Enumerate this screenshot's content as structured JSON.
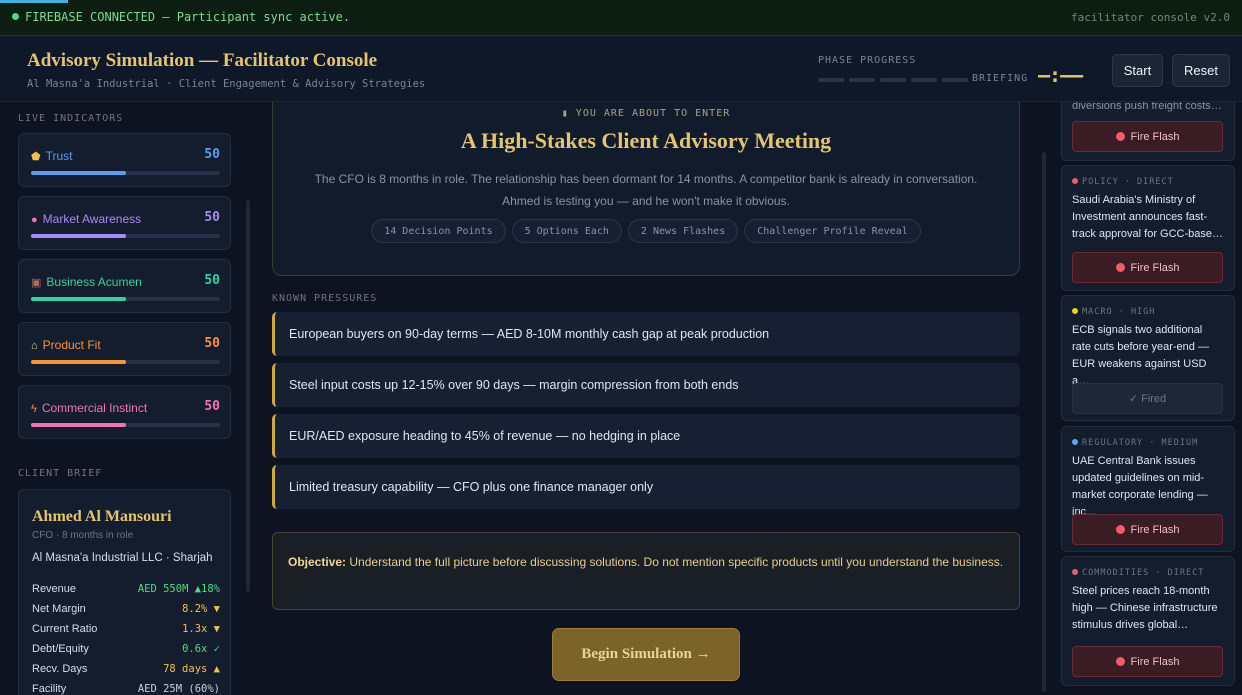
{
  "status_bar": {
    "status_text": "FIREBASE CONNECTED — Participant sync active.",
    "version": "facilitator console v2.0"
  },
  "header": {
    "title": "Advisory Simulation — Facilitator Console",
    "subtitle": "Al Masna'a Industrial · Client Engagement & Advisory Strategies",
    "phase_label": "PHASE PROGRESS",
    "phase_name": "BRIEFING",
    "timer": "–:––",
    "start_label": "Start",
    "reset_label": "Reset"
  },
  "indicators": {
    "section_label": "LIVE INDICATORS",
    "items": [
      {
        "icon": "shield-icon",
        "glyph": "⬟",
        "label": "Trust",
        "value": "50",
        "color": "#5b9df0",
        "level": 0.5
      },
      {
        "icon": "brain-icon",
        "glyph": "●",
        "label": "Market Awareness",
        "value": "50",
        "color": "#a78bfa",
        "level": 0.5
      },
      {
        "icon": "briefcase-icon",
        "glyph": "▣",
        "label": "Business Acumen",
        "value": "50",
        "color": "#34d399",
        "level": 0.5
      },
      {
        "icon": "bank-icon",
        "glyph": "⌂",
        "label": "Product Fit",
        "value": "50",
        "color": "#fb923c",
        "level": 0.5
      },
      {
        "icon": "lightning-icon",
        "glyph": "ϟ",
        "label": "Commercial Instinct",
        "value": "50",
        "color": "#f472b6",
        "level": 0.5
      }
    ]
  },
  "client_brief": {
    "section_label": "CLIENT BRIEF",
    "name": "Ahmed Al Mansouri",
    "role": "CFO · 8 months in role",
    "company": "Al Masna'a Industrial LLC · Sharjah",
    "metrics": [
      {
        "label": "Revenue",
        "value": "AED 550M ▲18%",
        "color": "#4ade80"
      },
      {
        "label": "Net Margin",
        "value": "8.2% ▼",
        "color": "#f5c04a"
      },
      {
        "label": "Current Ratio",
        "value": "1.3x ▼",
        "color": "#f5c04a"
      },
      {
        "label": "Debt/Equity",
        "value": "0.6x ✓",
        "color": "#4ade80"
      },
      {
        "label": "Recv. Days",
        "value": "78 days ▲",
        "color": "#f5c04a"
      },
      {
        "label": "Facility",
        "value": "AED 25M (60%)",
        "color": "#c8cfdb"
      }
    ]
  },
  "intro": {
    "eyebrow": "YOU ARE ABOUT TO ENTER",
    "title": "A High-Stakes Client Advisory Meeting",
    "description": "The CFO is 8 months in role. The relationship has been dormant for 14 months. A competitor bank is already in conversation. Ahmed is testing you — and he won't make it obvious.",
    "chips": [
      "14 Decision Points",
      "5 Options Each",
      "2 News Flashes",
      "Challenger Profile Reveal"
    ]
  },
  "pressures": {
    "section_label": "KNOWN PRESSURES",
    "items": [
      "European buyers on 90-day terms — AED 8-10M monthly cash gap at peak production",
      "Steel input costs up 12-15% over 90 days — margin compression from both ends",
      "EUR/AED exposure heading to 45% of revenue — no hedging in place",
      "Limited treasury capability — CFO plus one finance manager only"
    ]
  },
  "objective": {
    "label": "Objective:",
    "text": "Understand the full picture before discussing solutions. Do not mention specific products until you understand the business."
  },
  "begin_label": "Begin Simulation →",
  "news_feed": {
    "partial_headline": "diversions push freight costs…",
    "items": [
      {
        "meta": "POLICY · DIRECT",
        "dot_color": "#f05a6e",
        "headline": "Saudi Arabia's Ministry of Investment announces fast-track approval for GCC-base…",
        "button": "Fire Flash",
        "fired": false
      },
      {
        "meta": "MACRO · HIGH",
        "dot_color": "#facc15",
        "headline": "ECB signals two additional rate cuts before year-end — EUR weakens against USD a…",
        "button": "✓ Fired",
        "fired": true
      },
      {
        "meta": "REGULATORY · MEDIUM",
        "dot_color": "#60a5fa",
        "headline": "UAE Central Bank issues updated guidelines on mid-market corporate lending — inc…",
        "button": "Fire Flash",
        "fired": false
      },
      {
        "meta": "COMMODITIES · DIRECT",
        "dot_color": "#f05a6e",
        "headline": "Steel prices reach 18-month high — Chinese infrastructure stimulus drives global…",
        "button": "Fire Flash",
        "fired": false
      }
    ],
    "first_button": "Fire Flash"
  }
}
